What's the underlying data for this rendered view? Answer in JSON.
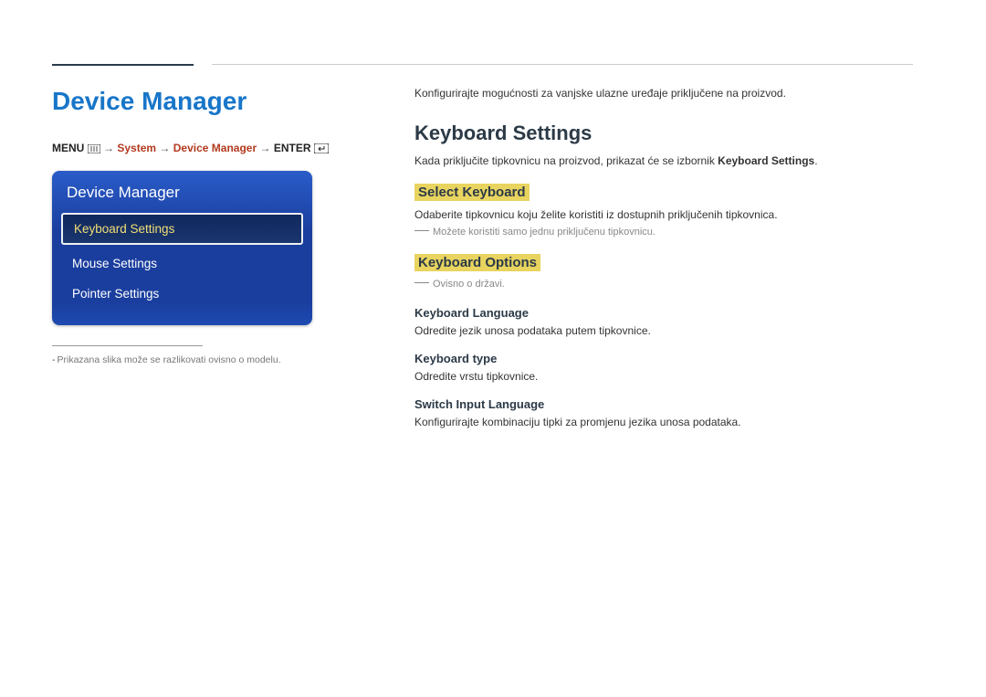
{
  "page_title": "Device Manager",
  "breadcrumb": {
    "menu": "MENU",
    "arrow": "→",
    "system": "System",
    "device_manager": "Device Manager",
    "enter": "ENTER"
  },
  "panel": {
    "header": "Device Manager",
    "items": [
      {
        "label": "Keyboard Settings",
        "selected": true
      },
      {
        "label": "Mouse Settings",
        "selected": false
      },
      {
        "label": "Pointer Settings",
        "selected": false
      }
    ]
  },
  "left_footnote": "Prikazana slika može se razlikovati ovisno o modelu.",
  "content": {
    "intro": "Konfigurirajte mogućnosti za vanjske ulazne uređaje priključene na proizvod.",
    "h2": "Keyboard Settings",
    "desc_prefix": "Kada priključite tipkovnicu na proizvod, prikazat će se izbornik ",
    "desc_strong": "Keyboard Settings",
    "desc_suffix": ".",
    "sections": [
      {
        "h3": "Select Keyboard",
        "desc": "Odaberite tipkovnicu koju želite koristiti iz dostupnih priključenih tipkovnica.",
        "note": "Možete koristiti samo jednu priključenu tipkovnicu."
      },
      {
        "h3": "Keyboard Options",
        "note": "Ovisno o državi.",
        "subsections": [
          {
            "h4": "Keyboard Language",
            "text": "Odredite jezik unosa podataka putem tipkovnice."
          },
          {
            "h4": "Keyboard type",
            "text": "Odredite vrstu tipkovnice."
          },
          {
            "h4": "Switch Input Language",
            "text": "Konfigurirajte kombinaciju tipki za promjenu jezika unosa podataka."
          }
        ]
      }
    ]
  }
}
